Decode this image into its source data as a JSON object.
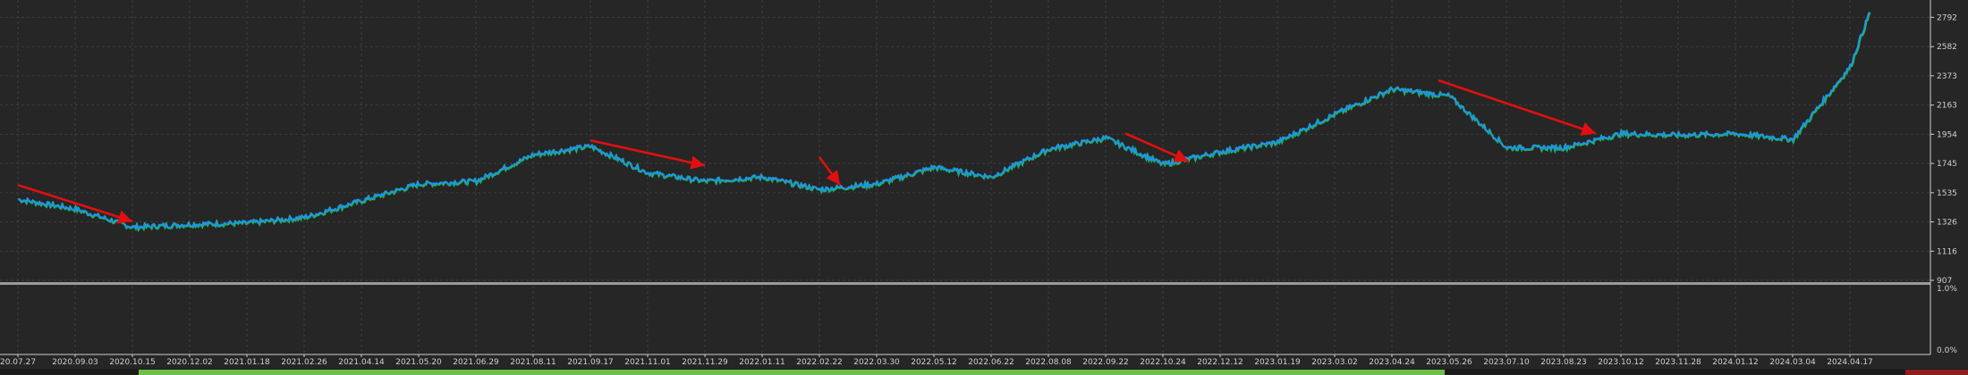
{
  "chart_data": {
    "type": "line",
    "title": "",
    "xlabel": "",
    "ylabel": "",
    "x_tick_labels": [
      "20.07.27",
      "2020.09.03",
      "2020.10.15",
      "2020.12.02",
      "2021.01.18",
      "2021.02.26",
      "2021.04.14",
      "2021.05.20",
      "2021.06.29",
      "2021.08.11",
      "2021.09.17",
      "2021.11.01",
      "2021.11.29",
      "2022.01.11",
      "2022.02.22",
      "2022.03.30",
      "2022.05.12",
      "2022.06.22",
      "2022.08.08",
      "2022.09.22",
      "2022.10.24",
      "2022.12.12",
      "2023.01.19",
      "2023.03.02",
      "2023.04.24",
      "2023.05.26",
      "2023.07.10",
      "2023.08.23",
      "2023.10.12",
      "2023.11.28",
      "2024.01.12",
      "2024.03.04",
      "2024.04.17"
    ],
    "y_tick_labels": [
      "907",
      "1116",
      "1326",
      "1535",
      "1745",
      "1954",
      "2163",
      "2373",
      "2582",
      "2792"
    ],
    "ylim": [
      907,
      2900
    ],
    "indicator_ticks": [
      "1.0%",
      "0.0%"
    ],
    "series": [
      {
        "color": "#1e90ff",
        "x": [
          "2020.07.27",
          "2020.09.03",
          "2020.10.15",
          "2020.12.02",
          "2021.01.18",
          "2021.02.26",
          "2021.04.14",
          "2021.05.20",
          "2021.06.29",
          "2021.08.11",
          "2021.09.17",
          "2021.11.01",
          "2021.11.29",
          "2022.01.11",
          "2022.02.22",
          "2022.03.30",
          "2022.05.12",
          "2022.06.22",
          "2022.08.08",
          "2022.09.22",
          "2022.10.24",
          "2022.12.12",
          "2023.01.19",
          "2023.03.02",
          "2023.04.24",
          "2023.05.26",
          "2023.07.10",
          "2023.08.23",
          "2023.10.12",
          "2023.11.28",
          "2024.01.12",
          "2024.03.04",
          "2024.04.17",
          "2024.05.02"
        ],
        "values": [
          1490,
          1420,
          1290,
          1310,
          1320,
          1360,
          1480,
          1600,
          1620,
          1810,
          1870,
          1680,
          1620,
          1650,
          1560,
          1600,
          1720,
          1650,
          1850,
          1930,
          1740,
          1830,
          1900,
          2100,
          2280,
          2230,
          1860,
          1860,
          1960,
          1950,
          1960,
          1920,
          2440,
          2830
        ]
      }
    ],
    "annotations": [
      {
        "x1": "2020.07.27",
        "y1": 1590,
        "x2": "2020.10.15",
        "y2": 1330,
        "color": "#e01010"
      },
      {
        "x1": "2021.09.17",
        "y1": 1910,
        "x2": "2021.11.29",
        "y2": 1730,
        "color": "#e01010"
      },
      {
        "x1": "2022.02.22",
        "y1": 1790,
        "x2": "2022.03.07",
        "y2": 1590,
        "color": "#e01010"
      },
      {
        "x1": "2022.10.03",
        "y1": 1960,
        "x2": "2022.11.15",
        "y2": 1760,
        "color": "#e01010"
      },
      {
        "x1": "2023.05.20",
        "y1": 2340,
        "x2": "2023.09.20",
        "y2": 1960,
        "color": "#e01010"
      }
    ],
    "colors": {
      "background": "#262626",
      "line": "#1e90ff",
      "noise": "#22b14c",
      "arrow": "#e01010",
      "axis_text": "#d0d0d0",
      "separator": "#aaaaaa"
    },
    "grid": true
  }
}
